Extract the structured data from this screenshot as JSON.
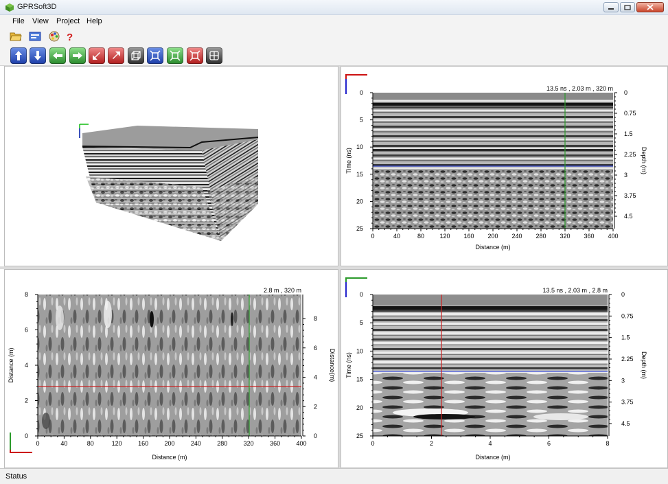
{
  "window": {
    "title": "GPRSoft3D"
  },
  "menu": [
    "File",
    "View",
    "Project",
    "Help"
  ],
  "toolbar1": [
    {
      "icon": "open-folder-icon"
    },
    {
      "icon": "project-settings-icon"
    },
    {
      "icon": "color-palette-icon"
    },
    {
      "icon": "help-icon"
    }
  ],
  "toolbar2": [
    {
      "icon": "move-up-icon",
      "color": "#1d3ea8"
    },
    {
      "icon": "move-down-icon",
      "color": "#1d3ea8"
    },
    {
      "icon": "move-left-icon",
      "color": "#2a8a2c"
    },
    {
      "icon": "move-right-icon",
      "color": "#2a8a2c"
    },
    {
      "icon": "move-diagonal-down-icon",
      "color": "#b01c1c"
    },
    {
      "icon": "move-diagonal-up-icon",
      "color": "#b01c1c"
    },
    {
      "icon": "cube-view-icon",
      "color": "#2f2f2f"
    },
    {
      "icon": "select-blue-icon",
      "color": "#1d3ea8"
    },
    {
      "icon": "select-green-icon",
      "color": "#2a8a2c"
    },
    {
      "icon": "select-red-icon",
      "color": "#b01c1c"
    },
    {
      "icon": "grid-icon",
      "color": "#2f2f2f"
    }
  ],
  "views": {
    "top_right": {
      "readout": "13.5 ns , 2.03 m , 320   m",
      "xlabel": "Distance (m)",
      "ylabel_left": "Time (ns)",
      "ylabel_right": "Depth (m)",
      "xticks": [
        "0",
        "40",
        "80",
        "120",
        "160",
        "200",
        "240",
        "280",
        "320",
        "360",
        "400"
      ],
      "yticks_left": [
        "0",
        "5",
        "10",
        "15",
        "20",
        "25"
      ],
      "yticks_right": [
        "0",
        "0.75",
        "1.5",
        "2.25",
        "3",
        "3.75",
        "4.5"
      ]
    },
    "bottom_left": {
      "readout": "2.8 m ,  320   m",
      "xlabel": "Distance (m)",
      "ylabel_left": "Distance (m)",
      "ylabel_right": "Distance(m)",
      "xticks": [
        "0",
        "40",
        "80",
        "120",
        "160",
        "200",
        "240",
        "280",
        "320",
        "360",
        "400"
      ],
      "yticks_left": [
        "0",
        "2",
        "4",
        "6",
        "8"
      ],
      "yticks_right": [
        "0",
        "2",
        "4",
        "6",
        "8"
      ]
    },
    "bottom_right": {
      "readout": "13.5 ns , 2.03 m , 2.8 m",
      "xlabel": "Distance (m)",
      "ylabel_left": "Time (ns)",
      "ylabel_right": "Depth (m)",
      "xticks": [
        "0",
        "2",
        "4",
        "6",
        "8"
      ],
      "yticks_left": [
        "0",
        "5",
        "10",
        "15",
        "20",
        "25"
      ],
      "yticks_right": [
        "0",
        "0.75",
        "1.5",
        "2.25",
        "3",
        "3.75",
        "4.5"
      ]
    }
  },
  "colors": {
    "time_cursor": "#3344cc",
    "distance_cursor_green": "#2a9a2a",
    "distance_cursor_red": "#cc2222"
  },
  "status": {
    "text": "Status"
  }
}
